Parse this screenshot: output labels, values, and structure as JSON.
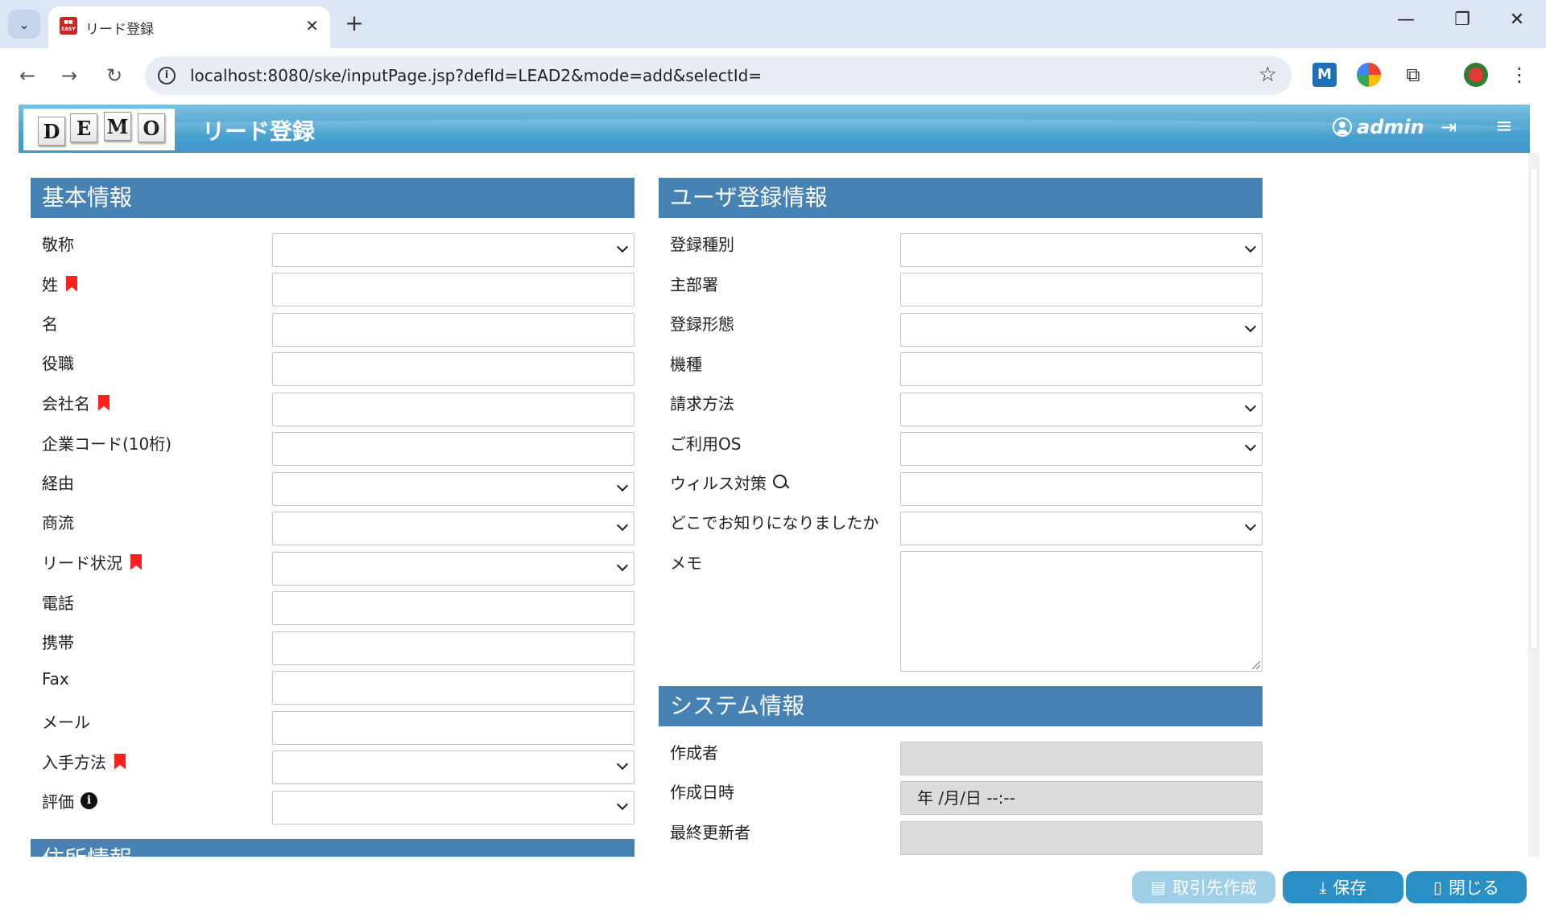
{
  "browser": {
    "tab_title": "リード登録",
    "url": "localhost:8080/ske/inputPage.jsp?defId=LEAD2&mode=add&selectId="
  },
  "header": {
    "logo_letters": [
      "D",
      "E",
      "M",
      "O"
    ],
    "title": "リード登録",
    "user": "admin"
  },
  "sections": {
    "basic": {
      "title": "基本情報",
      "fields": [
        {
          "label": "敬称",
          "type": "select",
          "required": false
        },
        {
          "label": "姓",
          "type": "input",
          "required": true
        },
        {
          "label": "名",
          "type": "input",
          "required": false
        },
        {
          "label": "役職",
          "type": "input",
          "required": false
        },
        {
          "label": "会社名",
          "type": "input",
          "required": true
        },
        {
          "label": "企業コード(10桁)",
          "type": "input",
          "required": false
        },
        {
          "label": "経由",
          "type": "select",
          "required": false
        },
        {
          "label": "商流",
          "type": "select",
          "required": false
        },
        {
          "label": "リード状況",
          "type": "select",
          "required": true
        },
        {
          "label": "電話",
          "type": "input",
          "required": false
        },
        {
          "label": "携帯",
          "type": "input",
          "required": false
        },
        {
          "label": "Fax",
          "type": "input",
          "required": false
        },
        {
          "label": "メール",
          "type": "input",
          "required": false
        },
        {
          "label": "入手方法",
          "type": "select",
          "required": true
        },
        {
          "label": "評価",
          "type": "select",
          "required": false,
          "info": true
        }
      ]
    },
    "address": {
      "title": "住所情報"
    },
    "user_reg": {
      "title": "ユーザ登録情報",
      "fields": [
        {
          "label": "登録種別",
          "type": "select"
        },
        {
          "label": "主部署",
          "type": "input"
        },
        {
          "label": "登録形態",
          "type": "select"
        },
        {
          "label": "機種",
          "type": "input"
        },
        {
          "label": "請求方法",
          "type": "select"
        },
        {
          "label": "ご利用OS",
          "type": "select"
        },
        {
          "label": "ウィルス対策",
          "type": "input",
          "search": true
        },
        {
          "label": "どこでお知りになりましたか",
          "type": "select"
        },
        {
          "label": "メモ",
          "type": "textarea"
        }
      ]
    },
    "system": {
      "title": "システム情報",
      "fields": [
        {
          "label": "作成者",
          "value": ""
        },
        {
          "label": "作成日時",
          "value": "年 /月/日 --:--"
        },
        {
          "label": "最終更新者",
          "value": ""
        }
      ]
    }
  },
  "buttons": {
    "create_partner": "取引先作成",
    "save": "保存",
    "close": "閉じる"
  },
  "colors": {
    "section_header": "#4682b4",
    "required_mark": "#ff1f1f",
    "button_primary": "#2a8fc4",
    "button_disabled": "#9fd0e8"
  }
}
